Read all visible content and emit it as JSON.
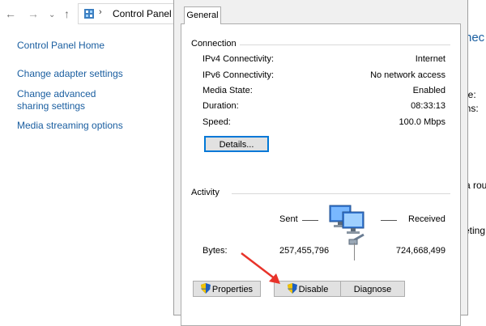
{
  "explorer": {
    "address_path": "Control Panel",
    "icons": [
      "back-arrow-icon",
      "forward-arrow-icon",
      "chevron-down-icon",
      "up-arrow-icon",
      "control-panel-icon"
    ],
    "sidebar": {
      "home": "Control Panel Home",
      "links": [
        "Change adapter settings",
        "Change advanced sharing settings",
        "Media streaming options"
      ]
    },
    "right_peek": {
      "heading": "nec",
      "lines": [
        "pe:",
        "ons:",
        "a rou",
        "eting"
      ]
    }
  },
  "dialog": {
    "tab": "General",
    "connection": {
      "title": "Connection",
      "rows": [
        {
          "label": "IPv4 Connectivity:",
          "value": "Internet"
        },
        {
          "label": "IPv6 Connectivity:",
          "value": "No network access"
        },
        {
          "label": "Media State:",
          "value": "Enabled"
        },
        {
          "label": "Duration:",
          "value": "08:33:13"
        },
        {
          "label": "Speed:",
          "value": "100.0 Mbps"
        }
      ],
      "details_button": "Details..."
    },
    "activity": {
      "title": "Activity",
      "sent_label": "Sent",
      "received_label": "Received",
      "bytes_label": "Bytes:",
      "bytes_sent": "257,455,796",
      "bytes_received": "724,668,499"
    },
    "buttons": {
      "properties": "Properties",
      "disable": "Disable",
      "diagnose": "Diagnose"
    },
    "colors": {
      "link": "#1a5ea0",
      "focus_border": "#0078d7",
      "annotation_arrow": "#e8332a"
    }
  }
}
